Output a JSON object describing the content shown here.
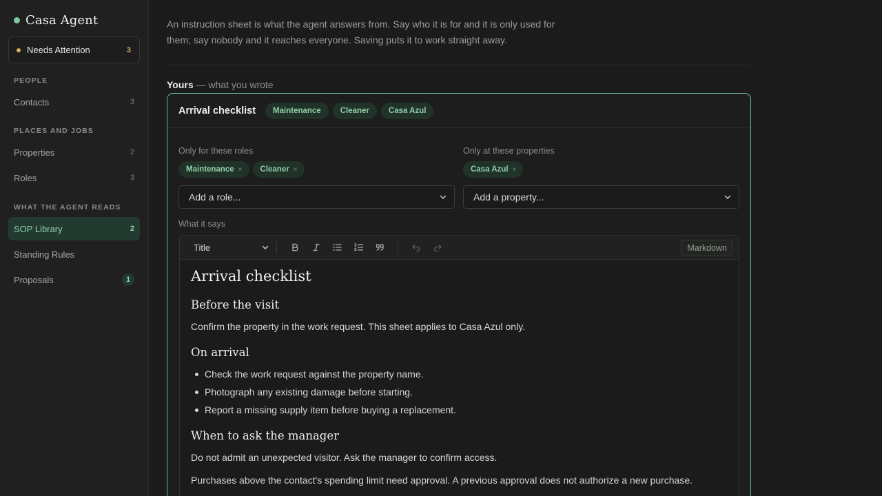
{
  "app": {
    "title": "Casa Agent"
  },
  "sidebar": {
    "needs_attention": {
      "label": "Needs Attention",
      "count": "3"
    },
    "sections": [
      {
        "heading": "PEOPLE",
        "items": [
          {
            "label": "Contacts",
            "count": "3"
          }
        ]
      },
      {
        "heading": "PLACES AND JOBS",
        "items": [
          {
            "label": "Properties",
            "count": "2"
          },
          {
            "label": "Roles",
            "count": "3"
          }
        ]
      },
      {
        "heading": "WHAT THE AGENT READS",
        "items": [
          {
            "label": "SOP Library",
            "count": "2",
            "active": true
          },
          {
            "label": "Standing Rules",
            "count": ""
          },
          {
            "label": "Proposals",
            "count": "1"
          }
        ]
      }
    ]
  },
  "main": {
    "intro": "An instruction sheet is what the agent answers from. Say who it is for and it is only used for them; say nobody and it reaches everyone. Saving puts it to work straight away.",
    "yours_strong": "Yours",
    "yours_muted": " — what you wrote",
    "card": {
      "title": "Arrival checklist",
      "tags": [
        "Maintenance",
        "Cleaner",
        "Casa Azul"
      ],
      "roles_label": "Only for these roles",
      "roles": [
        "Maintenance",
        "Cleaner"
      ],
      "properties_label": "Only at these properties",
      "properties": [
        "Casa Azul"
      ],
      "role_placeholder": "Add a role...",
      "property_placeholder": "Add a property...",
      "what_it_says_label": "What it says",
      "chip_remove": "×"
    },
    "editor": {
      "block_type": "Title",
      "markdown_label": "Markdown",
      "doc": {
        "h1": "Arrival checklist",
        "h2_before": "Before the visit",
        "p_before": "Confirm the property in the work request. This sheet applies to Casa Azul only.",
        "h2_arrival": "On arrival",
        "arrival_items": [
          "Check the work request against the property name.",
          "Photograph any existing damage before starting.",
          "Report a missing supply item before buying a replacement."
        ],
        "h2_ask": "When to ask the manager",
        "p_ask_1": "Do not admit an unexpected visitor. Ask the manager to confirm access.",
        "p_ask_2": "Purchases above the contact's spending limit need approval. A previous approval does not authorize a new purchase."
      }
    }
  },
  "colors": {
    "accent": "#7fc8a3",
    "warning": "#d8b45a",
    "background": "#1a1b1a"
  }
}
